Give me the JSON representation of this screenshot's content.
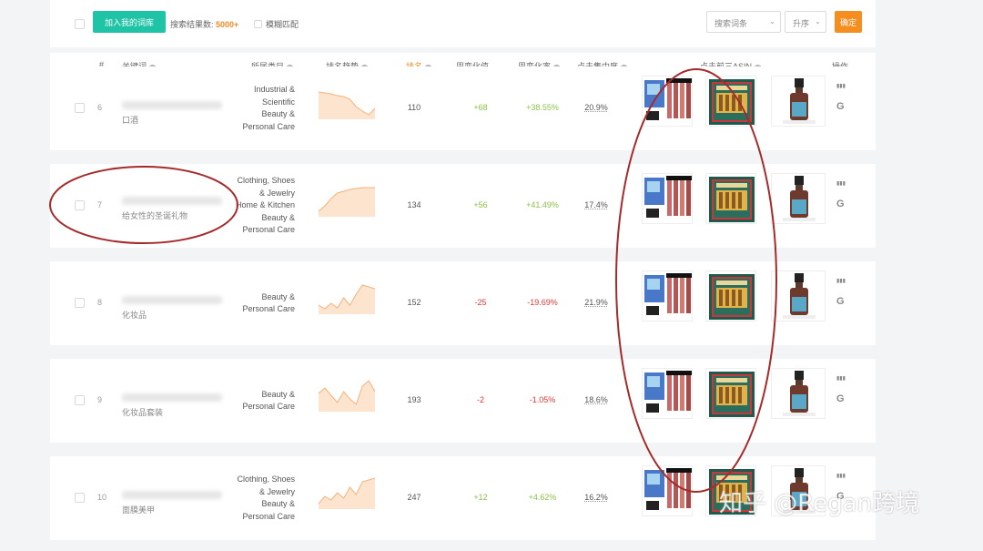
{
  "toolbar": {
    "add_button": "加入我的词库",
    "result_label": "搜索结果数:",
    "result_count": "5000+",
    "fuzzy_label": "模糊匹配",
    "search_select": "搜索词条",
    "filter_select": "升序",
    "confirm_button": "确定"
  },
  "columns": {
    "index": "#",
    "keyword": "关键词",
    "category": "所属类目",
    "trend": "排名趋势",
    "rank": "排名",
    "weekly_change": "周变化值",
    "weekly_rate": "周变化率",
    "click_share": "点击集中度",
    "top3_asin": "点击前三ASIN",
    "actions": "操作"
  },
  "rows": [
    {
      "index": "6",
      "keyword_cn": "口酒",
      "category": [
        "Industrial &",
        "Scientific",
        "Beauty &",
        "Personal Care"
      ],
      "rank": "110",
      "change": "+68",
      "rate": "+38.55%",
      "click_share": "20.9%",
      "trend": [
        10,
        11,
        12,
        14,
        15,
        18,
        26,
        31,
        35,
        28
      ],
      "change_sign": "pos"
    },
    {
      "index": "7",
      "keyword_cn": "给女性的圣诞礼物",
      "category": [
        "Clothing, Shoes",
        "& Jewelry",
        "Home & Kitchen",
        "Beauty &",
        "Personal Care"
      ],
      "rank": "134",
      "change": "+56",
      "rate": "+41.49%",
      "click_share": "17.4%",
      "trend": [
        34,
        28,
        20,
        14,
        12,
        10,
        9,
        8,
        8,
        8
      ],
      "change_sign": "pos"
    },
    {
      "index": "8",
      "keyword_cn": "化妆品",
      "category": [
        "Beauty &",
        "Personal Care"
      ],
      "rank": "152",
      "change": "-25",
      "rate": "-19.69%",
      "click_share": "21.9%",
      "trend": [
        30,
        34,
        28,
        33,
        22,
        30,
        18,
        8,
        10,
        12
      ],
      "change_sign": "neg"
    },
    {
      "index": "9",
      "keyword_cn": "化妆品套装",
      "category": [
        "Beauty &",
        "Personal Care"
      ],
      "rank": "193",
      "change": "-2",
      "rate": "-1.05%",
      "click_share": "18.6%",
      "trend": [
        20,
        14,
        22,
        30,
        18,
        26,
        32,
        12,
        6,
        18
      ],
      "change_sign": "neg"
    },
    {
      "index": "10",
      "keyword_cn": "面膜美甲",
      "category": [
        "Clothing, Shoes",
        "& Jewelry",
        "Beauty &",
        "Personal Care"
      ],
      "rank": "247",
      "change": "+12",
      "rate": "+4.62%",
      "click_share": "16.2%",
      "trend": [
        34,
        26,
        30,
        22,
        28,
        16,
        24,
        10,
        8,
        6
      ],
      "change_sign": "pos"
    }
  ],
  "watermark": "知乎 @Regan跨境",
  "colors": {
    "accent_green": "#1fc3a6",
    "accent_orange": "#f58e1e",
    "positive": "#8bc34a",
    "negative": "#e53935",
    "annotation": "#a52a2a"
  }
}
